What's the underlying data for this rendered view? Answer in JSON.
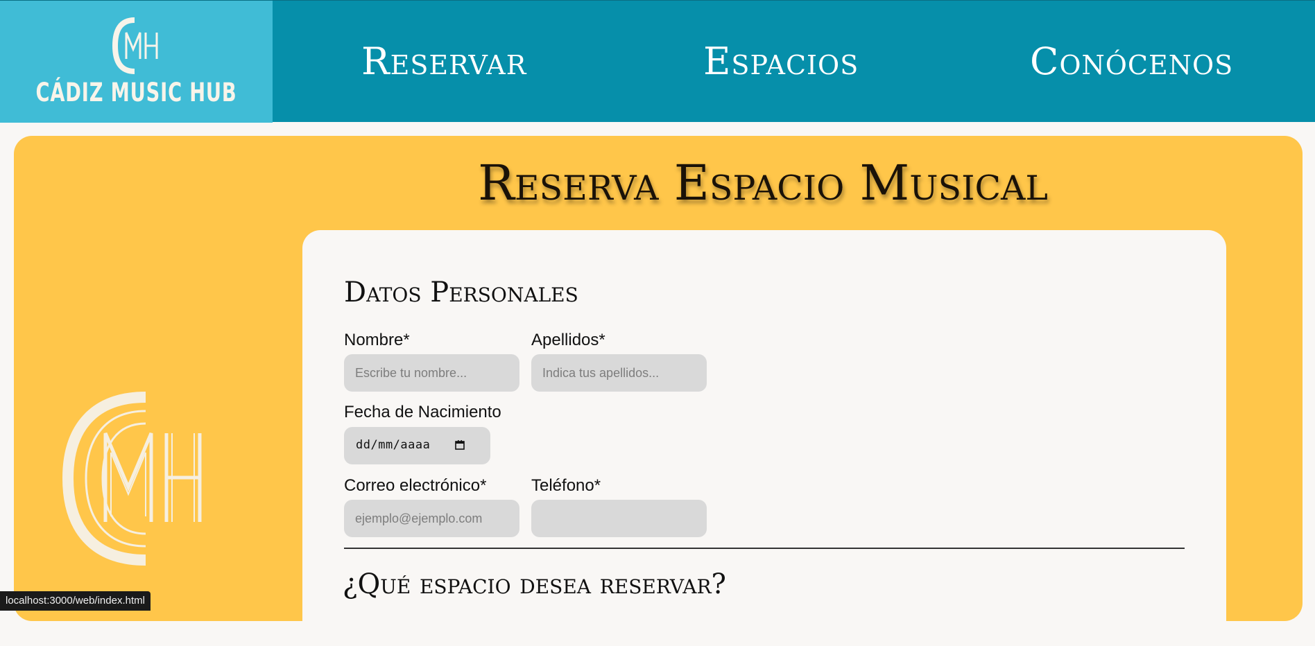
{
  "header": {
    "logo_text": "CÁDIZ MUSIC HUB",
    "logo_icon": "cmh-monogram-icon",
    "nav": [
      {
        "label": "Reservar"
      },
      {
        "label": "Espacios"
      },
      {
        "label": "Conócenos"
      }
    ]
  },
  "main": {
    "title": "Reserva Espacio Musical",
    "side_logo_icon": "cmh-monogram-icon"
  },
  "form": {
    "section_personal": "Datos Personales",
    "nombre_label": "Nombre*",
    "nombre_placeholder": "Escribe tu nombre...",
    "apellidos_label": "Apellidos*",
    "apellidos_placeholder": "Indica tus apellidos...",
    "fecha_label": "Fecha de Nacimiento",
    "fecha_value": "dd/mm/aaaa",
    "fecha_icon": "calendar-icon",
    "correo_label": "Correo electrónico*",
    "correo_placeholder": "ejemplo@ejemplo.com",
    "telefono_label": "Teléfono*",
    "telefono_placeholder": "",
    "section_espacio": "¿Qué espacio desea reservar?"
  },
  "status_bar": {
    "url": "localhost:3000/web/index.html"
  },
  "colors": {
    "header_bg": "#068faa",
    "logo_bg": "#40bcd6",
    "main_bg": "#ffc64a",
    "card_bg": "#f9f7f5",
    "field_bg": "#d9d9d9"
  }
}
